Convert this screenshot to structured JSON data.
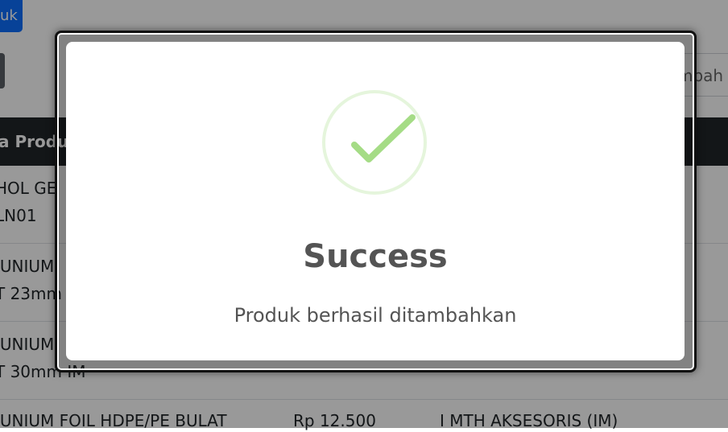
{
  "background": {
    "top_button_label": "uk",
    "search_placeholder": "mbah",
    "table_header": "a Produ",
    "rows": [
      {
        "line1": "HOL GE",
        "line2": "LN01"
      },
      {
        "line1": "IUNIUM",
        "line2": "T 23mm"
      },
      {
        "line1": "IUNIUM",
        "line2": "T 30mm IM"
      },
      {
        "name": "IUNIUM FOIL HDPE/PE BULAT",
        "price": "Rp 12.500",
        "category": "I MTH AKSESORIS (IM)"
      }
    ]
  },
  "modal": {
    "icon": "success-check-icon",
    "title": "Success",
    "message": "Produk berhasil ditambahkan"
  },
  "colors": {
    "primary": "#0d6efd",
    "success_ring": "#e5f5dc",
    "success_check": "#a5dc86",
    "text": "#545454"
  }
}
